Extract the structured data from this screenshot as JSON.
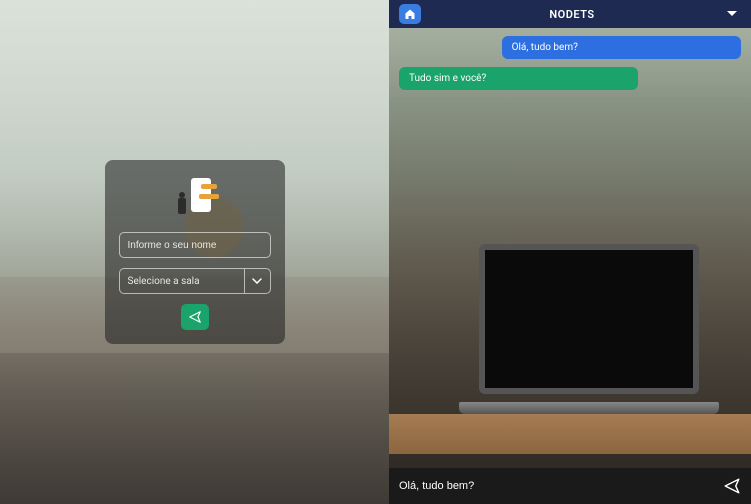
{
  "login": {
    "name_placeholder": "Informe o seu nome",
    "room_placeholder": "Selecione a sala",
    "submit_icon": "send-icon"
  },
  "chat": {
    "title": "NODETS",
    "messages": [
      {
        "type": "sent",
        "text": "Olá, tudo bem?"
      },
      {
        "type": "received",
        "text": "Tudo sim e você?"
      }
    ],
    "input_value": "Olá, tudo bem?"
  },
  "colors": {
    "header": "#1e2a52",
    "accent_blue": "#2d6fe0",
    "accent_green": "#1aa36a"
  }
}
